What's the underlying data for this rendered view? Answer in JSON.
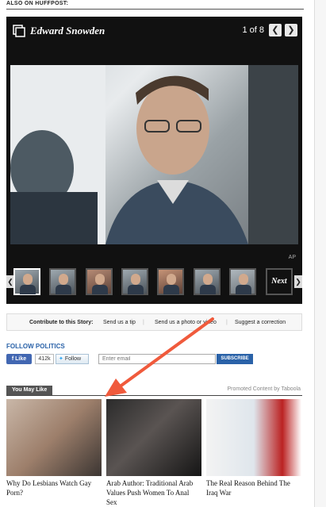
{
  "section_label": "ALSO ON HUFFPOST:",
  "slideshow": {
    "title": "Edward Snowden",
    "counter": "1 of 8",
    "prev_symbol": "❮",
    "next_symbol": "❯",
    "photo_credit": "AP",
    "next_label": "Next",
    "strip_prev_symbol": "❮",
    "strip_next_symbol": "❯",
    "thumbnail_count": 8
  },
  "contribute": {
    "label": "Contribute to this Story:",
    "links": [
      "Send us a tip",
      "Send us a photo or video",
      "Suggest a correction"
    ]
  },
  "follow": {
    "title": "FOLLOW POLITICS",
    "fb_like": "Like",
    "fb_count": "412k",
    "tw_follow": "Follow",
    "email_placeholder": "Enter email",
    "subscribe": "SUBSCRIBE"
  },
  "you_may_like": {
    "tab": "You May Like",
    "promoted": "Promoted Content by Taboola",
    "cards": [
      {
        "caption": "Why Do Lesbians Watch Gay Porn?"
      },
      {
        "caption": "Arab Author: Traditional Arab Values Push Women To Anal Sex"
      },
      {
        "caption": "The Real Reason Behind The Iraq War"
      }
    ]
  },
  "colors": {
    "accent_blue": "#2a62a8",
    "annotation_arrow": "#f05a3c",
    "slideshow_bg": "#111111"
  }
}
